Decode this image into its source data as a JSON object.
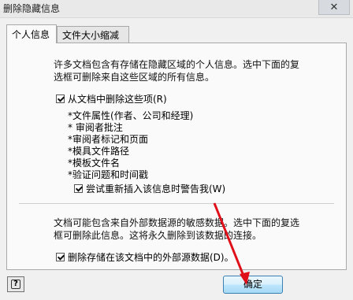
{
  "window": {
    "title": "删除隐藏信息",
    "close_glyph": "✕"
  },
  "tabs": [
    {
      "label": "个人信息",
      "active": true
    },
    {
      "label": "文件大小缩减",
      "active": false
    }
  ],
  "personal": {
    "intro_line1": "许多文档包含有存储在隐藏区域的个人信息。选中下面的复",
    "intro_line2": "选框可删除来自这些区域的所有信息。",
    "remove_items_checkbox": {
      "label": "从文档中删除这些项(R)",
      "checked": true
    },
    "items": [
      "*文件属性(作者、公司和经理)",
      "* 审阅者批注",
      "*审阅者标记和页面",
      "*模具文件路径",
      "*模板文件名",
      "*验证问题和时间戳"
    ],
    "warn_checkbox": {
      "label": "尝试重新插入该信息时警告我(W)",
      "checked": true
    },
    "external_line1": "文档可能包含来自外部数据源的敏感数据。选中下面的复选",
    "external_line2": "框可删除此信息。这将永久删除到该数据的连接。",
    "external_checkbox": {
      "label": "删除存储在该文档中的外部源数据(D)。",
      "checked": true
    }
  },
  "footer": {
    "help_glyph": "?",
    "ok_label": "确定"
  },
  "colors": {
    "arrow": "#e0101a"
  }
}
